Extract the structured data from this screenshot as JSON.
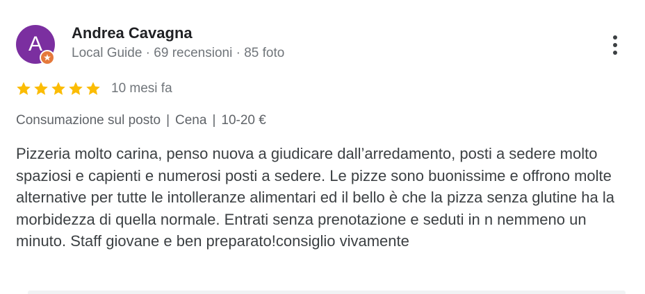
{
  "review": {
    "author": {
      "initial": "A",
      "name": "Andrea Cavagna",
      "meta": "Local Guide · 69 recensioni · 85 foto",
      "avatar_color": "#7b2fa0",
      "badge_color": "#e5793b"
    },
    "rating": {
      "stars": 5,
      "max_stars": 5,
      "star_color": "#fbbc04"
    },
    "date": "10 mesi fa",
    "tags": [
      "Consumazione sul posto",
      "Cena",
      "10-20 €"
    ],
    "tag_separator": "|",
    "text": "Pizzeria molto carina, penso nuova a giudicare dall’arredamento, posti a sedere molto spaziosi e capienti e numerosi posti a sedere. Le pizze sono buonissime e offrono molte alternative per tutte le intolleranze alimentari ed il bello è che la pizza senza glutine ha la morbidezza di quella normale. Entrati senza prenotazione e seduti in n nemmeno un minuto. Staff giovane e ben preparato!consiglio vivamente",
    "more_icon": "more-vert-icon"
  }
}
